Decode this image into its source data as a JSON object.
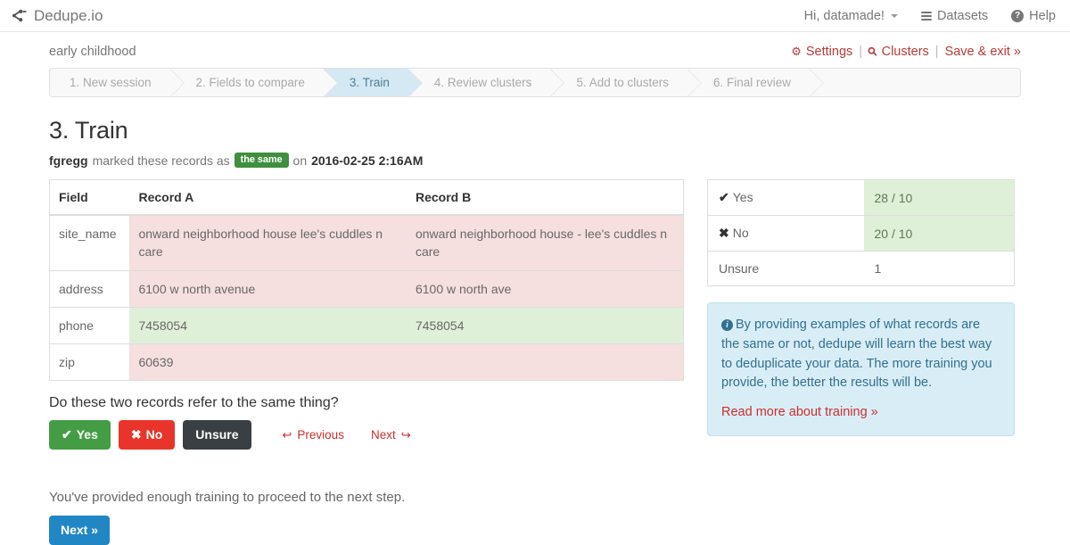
{
  "navbar": {
    "brand": "Dedupe.io",
    "brand_icon": "sitemap-icon",
    "user_menu": "Hi, datamade!",
    "datasets": "Datasets",
    "help": "Help"
  },
  "session": {
    "name": "early childhood",
    "actions": {
      "settings": "Settings",
      "clusters": "Clusters",
      "save_exit": "Save & exit »",
      "separator": "|"
    }
  },
  "stepper": {
    "steps": [
      {
        "label": "1. New session",
        "active": false
      },
      {
        "label": "2. Fields to compare",
        "active": false
      },
      {
        "label": "3. Train",
        "active": true
      },
      {
        "label": "4. Review clusters",
        "active": false
      },
      {
        "label": "5. Add to clusters",
        "active": false
      },
      {
        "label": "6. Final review",
        "active": false
      }
    ]
  },
  "main": {
    "title": "3. Train",
    "marked": {
      "user": "fgregg",
      "text_before": "marked these records as",
      "badge": "the same",
      "text_mid": "on",
      "timestamp": "2016-02-25 2:16AM"
    },
    "table": {
      "headers": [
        "Field",
        "Record A",
        "Record B"
      ],
      "rows": [
        {
          "field": "site_name",
          "a": "onward neighborhood house lee's cuddles n care",
          "b": "onward neighborhood house - lee's cuddles n care",
          "match": false
        },
        {
          "field": "address",
          "a": "6100 w north avenue",
          "b": "6100 w north ave",
          "match": false
        },
        {
          "field": "phone",
          "a": "7458054",
          "b": "7458054",
          "match": true
        },
        {
          "field": "zip",
          "a": "60639",
          "b": "",
          "match": false
        }
      ]
    },
    "question": "Do these two records refer to the same thing?",
    "buttons": {
      "yes": "Yes",
      "no": "No",
      "unsure": "Unsure",
      "previous": "Previous",
      "next_link": "Next"
    },
    "enough_text": "You've provided enough training to proceed to the next step.",
    "next_button": "Next »"
  },
  "sidebar": {
    "counts": [
      {
        "label": "Yes",
        "icon": "check-icon",
        "value": "28 / 10",
        "highlight": true
      },
      {
        "label": "No",
        "icon": "x-icon",
        "value": "20 / 10",
        "highlight": true
      },
      {
        "label": "Unsure",
        "icon": "",
        "value": "1",
        "highlight": false
      }
    ],
    "info": {
      "body": "By providing examples of what records are the same or not, dedupe will learn the best way to deduplicate your data. The more training you provide, the better the results will be.",
      "link": "Read more about training »"
    }
  },
  "colors": {
    "accent_blue": "#2186c4",
    "active_step": "#d4e9f3",
    "danger_red": "#c9302c",
    "success_green": "#449d44",
    "no_red": "#e8342a",
    "unsure_dark": "#3a3f44",
    "row_diff": "#f6dfdf",
    "row_same": "#dff0d8",
    "info_bg": "#d9edf7"
  }
}
